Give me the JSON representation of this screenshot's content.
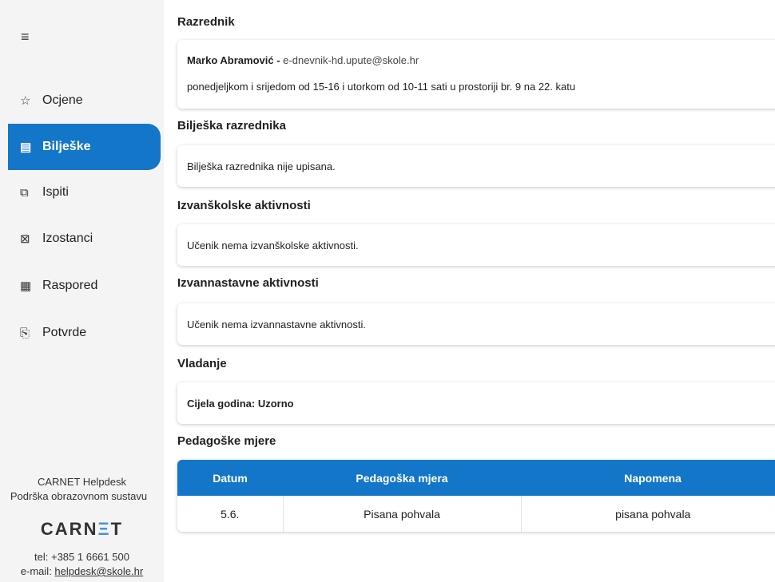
{
  "sidebar": {
    "menu_icon": "≡",
    "items": [
      {
        "icon": "star-icon",
        "glyph": "☆",
        "label": "Ocjene",
        "active": false
      },
      {
        "icon": "notes-icon",
        "glyph": "▤",
        "label": "Bilješke",
        "active": true
      },
      {
        "icon": "copy-icon",
        "glyph": "⧉",
        "label": "Ispiti",
        "active": false
      },
      {
        "icon": "calendar-off-icon",
        "glyph": "⊠",
        "label": "Izostanci",
        "active": false
      },
      {
        "icon": "calendar-grid-icon",
        "glyph": "▦",
        "label": "Raspored",
        "active": false
      },
      {
        "icon": "pdf-file-icon",
        "glyph": "⎘",
        "label": "Potvrde",
        "active": false
      }
    ],
    "helpdesk": {
      "line1": "CARNET Helpdesk",
      "line2": "Podrška obrazovnom sustavu",
      "logo_a": "CARN",
      "logo_e": "Ξ",
      "logo_b": "T",
      "tel": "tel: +385 1 6661 500",
      "email_label": "e-mail: ",
      "email": "helpdesk@skole.hr"
    }
  },
  "razrednik": {
    "title": "Razrednik",
    "name": "Marko Abramović -",
    "email": " e-dnevnik-hd.upute@skole.hr",
    "hours": "ponedjeljkom i srijedom od 15-16 i utorkom od 10-11 sati u prostoriji br. 9 na 22. katu"
  },
  "biljeska": {
    "title": "Bilješka razrednika",
    "text": "Bilješka razrednika nije upisana."
  },
  "izvanskolske": {
    "title": "Izvanškolske aktivnosti",
    "text": "Učenik nema izvanškolske aktivnosti."
  },
  "izvannastavne": {
    "title": "Izvannastavne aktivnosti",
    "text": "Učenik nema izvannastavne aktivnosti."
  },
  "vladanje": {
    "title": "Vladanje",
    "text": "Cijela godina: Uzorno"
  },
  "pedagoske": {
    "title": "Pedagoške mjere",
    "headers": [
      "Datum",
      "Pedagoška mjera",
      "Napomena"
    ],
    "rows": [
      [
        "5.6.",
        "Pisana pohvala",
        "pisana pohvala"
      ]
    ]
  },
  "colors": {
    "accent": "#1476c8",
    "sidebar_bg": "#f4f4f4"
  }
}
